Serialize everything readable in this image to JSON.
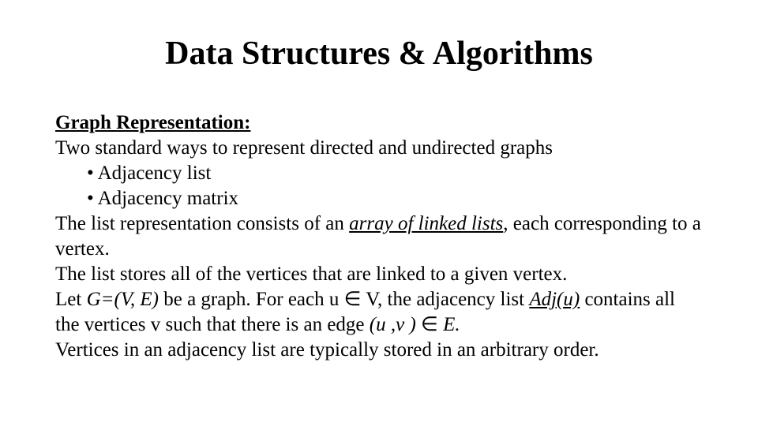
{
  "title": "Data Structures & Algorithms",
  "section_heading": "Graph Representation:",
  "intro": "Two standard ways to represent directed and undirected graphs",
  "bullets": [
    "Adjacency list",
    "Adjacency matrix"
  ],
  "para1_a": "The list representation consists of an ",
  "para1_b": "array of linked lists",
  "para1_c": ", each corresponding to a vertex.",
  "para2": "The list stores all of the vertices that are linked to a given vertex.",
  "para3_a": "Let ",
  "para3_b": "G=(V, E)",
  "para3_c": " be a graph. For each u ",
  "para3_elem": "∈",
  "para3_d": " V, the adjacency list ",
  "para3_e": "Adj(u)",
  "para3_f": " contains all the vertices v such that there is an edge ",
  "para3_g": "(u ,v )",
  "para3_h": "  ",
  "para3_elem2": "∈",
  "para3_i": "   ",
  "para3_j": "E.",
  "para4": "Vertices in an adjacency list are typically stored in an arbitrary order."
}
